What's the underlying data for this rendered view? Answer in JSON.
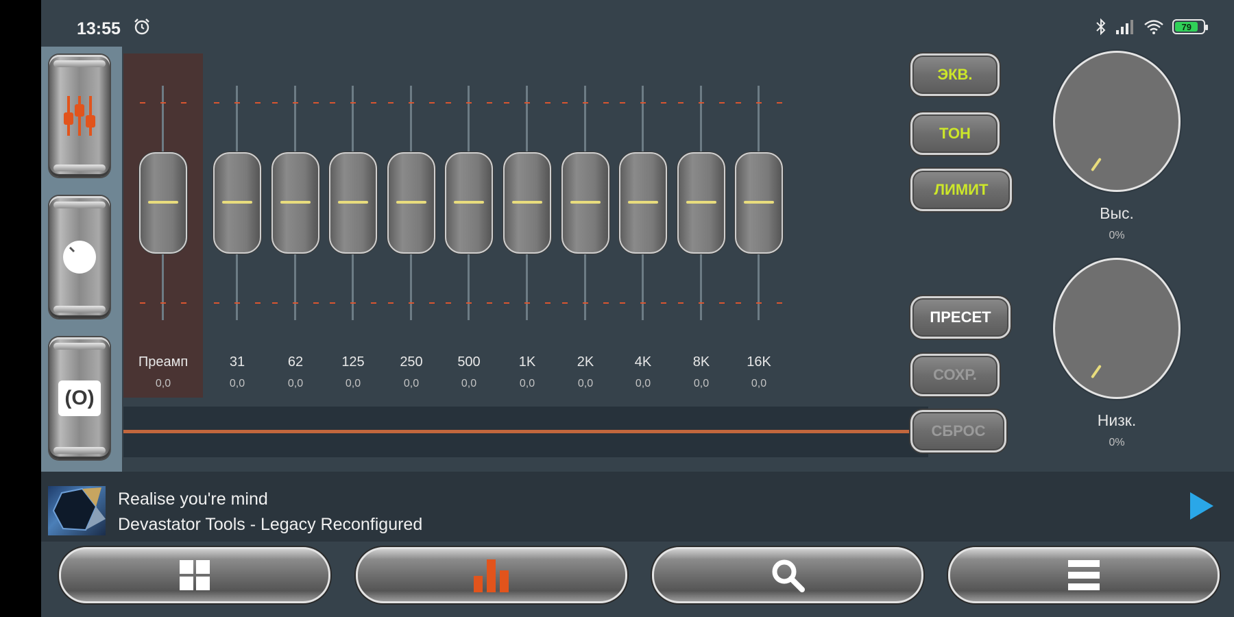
{
  "status_bar": {
    "time": "13:55",
    "battery_level": "79",
    "icons": [
      "alarm-icon",
      "bluetooth-icon",
      "signal-icon",
      "wifi-icon",
      "battery-icon"
    ]
  },
  "side_panel": {
    "items": [
      {
        "name": "equalizer-sliders",
        "icon": "equalizer-sliders-icon",
        "color": "#e2541c",
        "active": true
      },
      {
        "name": "knob",
        "icon": "knob-icon"
      },
      {
        "name": "surround",
        "icon": "surround-icon",
        "label": "(O)"
      }
    ]
  },
  "preamp": {
    "label": "Преамп",
    "value": "0,0"
  },
  "bands": [
    {
      "label": "31",
      "value": "0,0"
    },
    {
      "label": "62",
      "value": "0,0"
    },
    {
      "label": "125",
      "value": "0,0"
    },
    {
      "label": "250",
      "value": "0,0"
    },
    {
      "label": "500",
      "value": "0,0"
    },
    {
      "label": "1K",
      "value": "0,0"
    },
    {
      "label": "2K",
      "value": "0,0"
    },
    {
      "label": "4K",
      "value": "0,0"
    },
    {
      "label": "8K",
      "value": "0,0"
    },
    {
      "label": "16K",
      "value": "0,0"
    }
  ],
  "right_buttons": {
    "eq": "ЭКВ.",
    "tone": "ТОН",
    "limit": "ЛИМИТ",
    "preset": "ПРЕСЕТ",
    "save": "СОХР.",
    "reset": "СБРОС"
  },
  "dials": {
    "treble": {
      "label": "Выс.",
      "value": "0%"
    },
    "bass": {
      "label": "Низк.",
      "value": "0%"
    }
  },
  "now_playing": {
    "title": "Realise you're mind",
    "subtitle": "Devastator Tools - Legacy Reconfigured"
  },
  "bottom_nav": [
    "grid-icon",
    "equalizer-bars-icon",
    "search-icon",
    "menu-icon"
  ],
  "colors": {
    "accent": "#e2541c",
    "label_green": "#cce62a",
    "disabled": "#9a9a9a",
    "play": "#2aa7e8",
    "slider_mark": "#e8dc7d",
    "background": "#36424b"
  }
}
